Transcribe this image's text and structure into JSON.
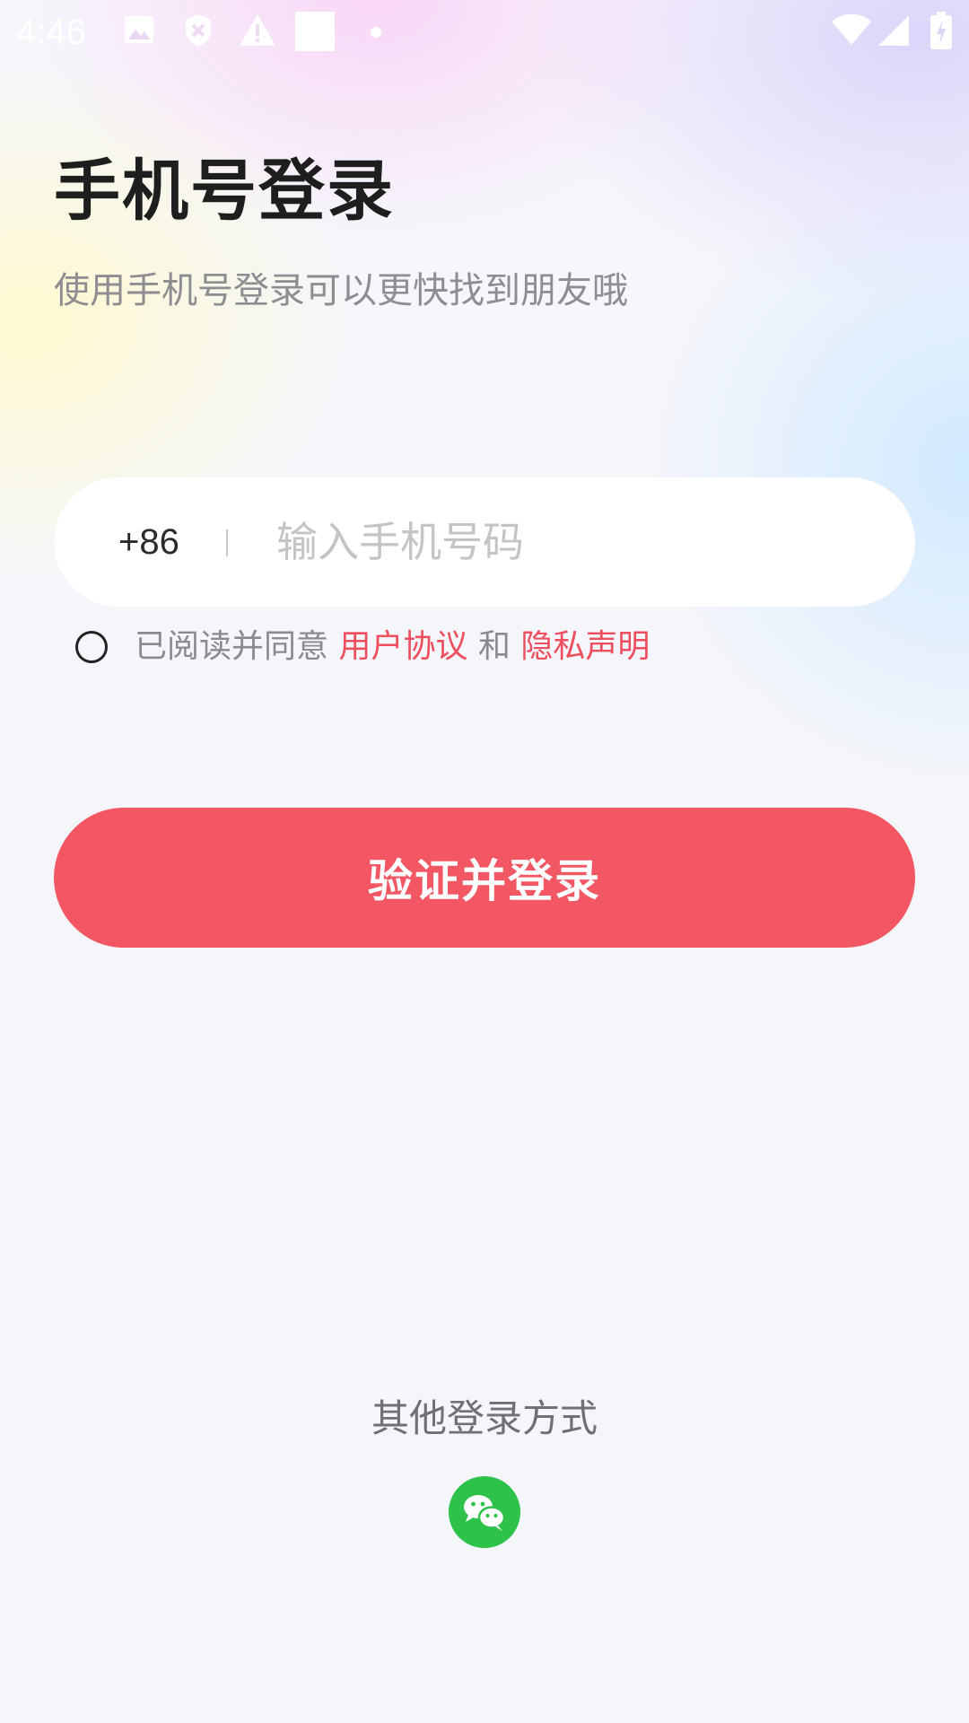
{
  "status_bar": {
    "time": "4:46",
    "icons": [
      "image-icon",
      "shield-icon",
      "warning-icon",
      "square-icon",
      "dot-icon",
      "wifi-icon",
      "signal-icon",
      "battery-icon"
    ]
  },
  "header": {
    "title": "手机号登录",
    "subtitle": "使用手机号登录可以更快找到朋友哦"
  },
  "phone": {
    "country_code": "+86",
    "value": "",
    "placeholder": "输入手机号码"
  },
  "agreement": {
    "checked": false,
    "prefix": "已阅读并同意",
    "user_agreement": "用户协议",
    "conjunction": "和",
    "privacy_policy": "隐私声明"
  },
  "login_button": {
    "label": "验证并登录"
  },
  "other_login": {
    "label": "其他登录方式",
    "methods": [
      "wechat-icon"
    ]
  },
  "colors": {
    "accent": "#f35763",
    "link": "#ee4e5e",
    "wechat": "#2ec24a",
    "title": "#1e1e1e",
    "muted": "#8d8d92"
  }
}
